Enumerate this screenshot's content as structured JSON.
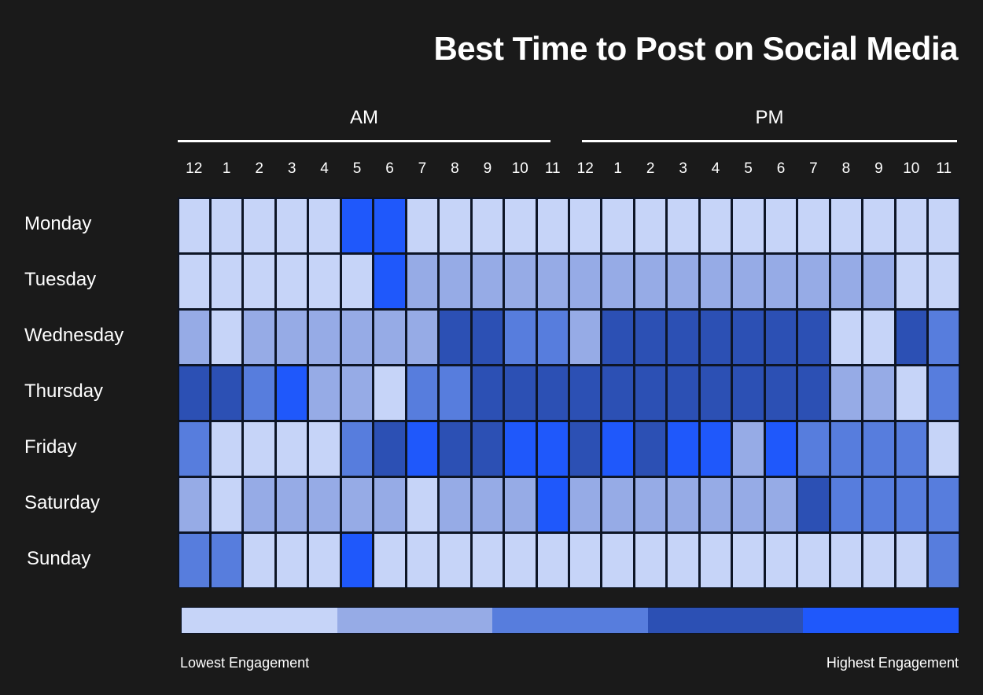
{
  "chart_data": {
    "type": "heatmap",
    "title": "Best Time to Post on Social Media",
    "periods": [
      {
        "label": "AM",
        "hours": [
          "12",
          "1",
          "2",
          "3",
          "4",
          "5",
          "6",
          "7",
          "8",
          "9",
          "10",
          "11"
        ]
      },
      {
        "label": "PM",
        "hours": [
          "12",
          "1",
          "2",
          "3",
          "4",
          "5",
          "6",
          "7",
          "8",
          "9",
          "10",
          "11"
        ]
      }
    ],
    "rows": [
      "Monday",
      "Tuesday",
      "Wednesday",
      "Thursday",
      "Friday",
      "Saturday",
      "Sunday"
    ],
    "scale": {
      "levels": [
        1,
        2,
        3,
        4,
        5
      ],
      "colors": [
        "#c6d4f8",
        "#96abe6",
        "#577ddd",
        "#2c50b4",
        "#1f58fb"
      ],
      "low_label": "Lowest Engagement",
      "high_label": "Highest Engagement"
    },
    "values": [
      [
        1,
        1,
        1,
        1,
        1,
        5,
        5,
        1,
        1,
        1,
        1,
        1,
        1,
        1,
        1,
        1,
        1,
        1,
        1,
        1,
        1,
        1,
        1,
        1
      ],
      [
        1,
        1,
        1,
        1,
        1,
        1,
        5,
        2,
        2,
        2,
        2,
        2,
        2,
        2,
        2,
        2,
        2,
        2,
        2,
        2,
        2,
        2,
        1,
        1
      ],
      [
        2,
        1,
        2,
        2,
        2,
        2,
        2,
        2,
        4,
        4,
        3,
        3,
        2,
        4,
        4,
        4,
        4,
        4,
        4,
        4,
        1,
        1,
        4,
        3
      ],
      [
        4,
        4,
        3,
        5,
        2,
        2,
        1,
        3,
        3,
        4,
        4,
        4,
        4,
        4,
        4,
        4,
        4,
        4,
        4,
        4,
        2,
        2,
        1,
        3
      ],
      [
        3,
        1,
        1,
        1,
        1,
        3,
        4,
        5,
        4,
        4,
        5,
        5,
        4,
        5,
        4,
        5,
        5,
        2,
        5,
        3,
        3,
        3,
        3,
        1
      ],
      [
        2,
        1,
        2,
        2,
        2,
        2,
        2,
        1,
        2,
        2,
        2,
        5,
        2,
        2,
        2,
        2,
        2,
        2,
        2,
        4,
        3,
        3,
        3,
        3
      ],
      [
        3,
        3,
        1,
        1,
        1,
        5,
        1,
        1,
        1,
        1,
        1,
        1,
        1,
        1,
        1,
        1,
        1,
        1,
        1,
        1,
        1,
        1,
        1,
        3
      ]
    ]
  }
}
